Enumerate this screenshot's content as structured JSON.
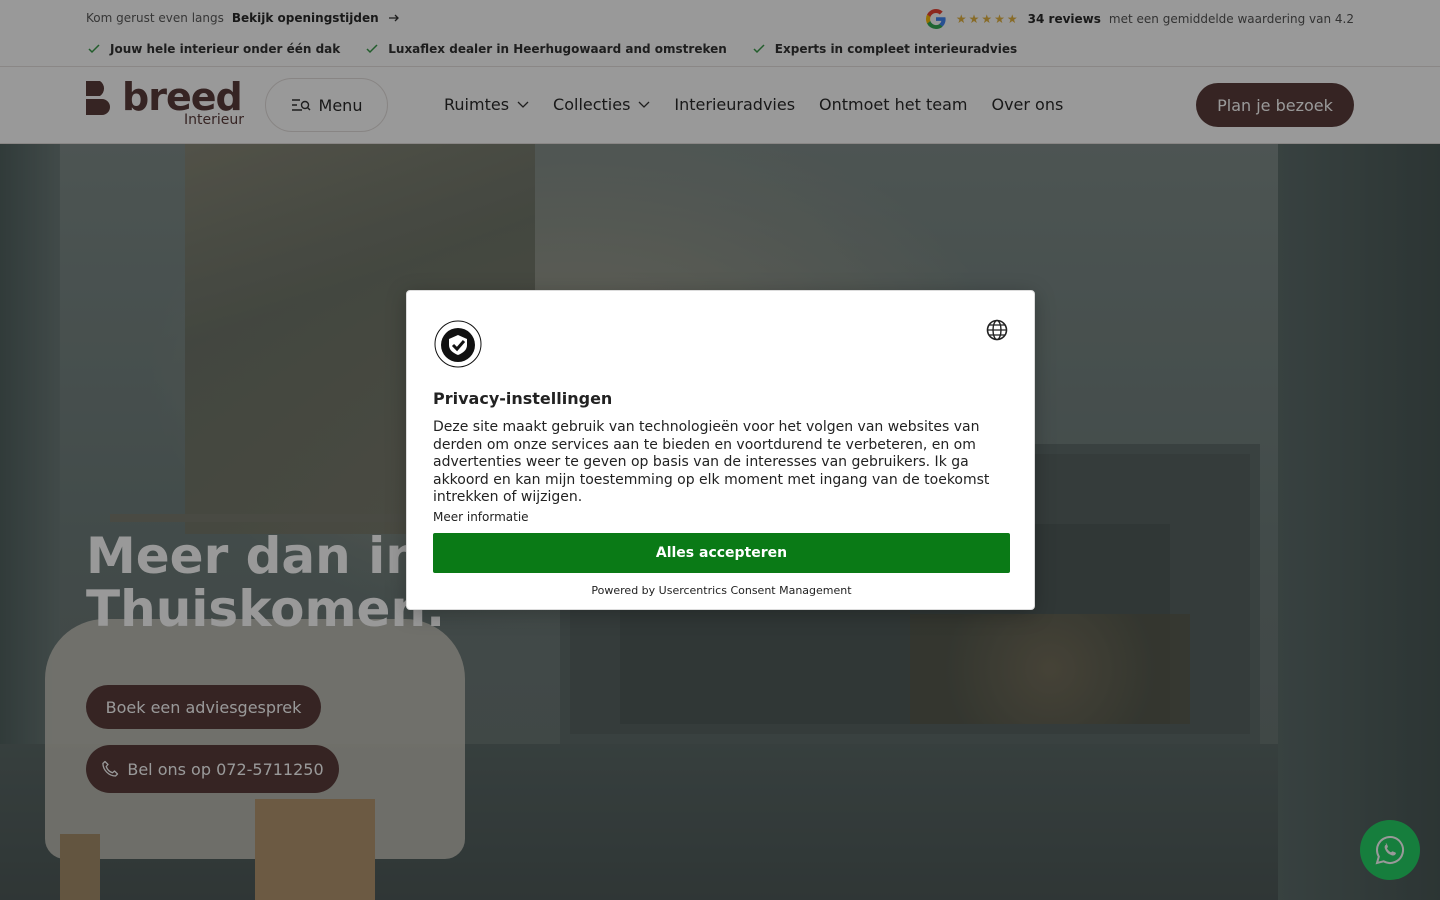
{
  "topbar": {
    "visit_text": "Kom gerust even langs",
    "visit_link": "Bekijk openingstijden",
    "usps": [
      "Jouw hele interieur onder één dak",
      "Luxaflex dealer in Heerhugowaard and omstreken",
      "Experts in compleet interieuradvies"
    ],
    "reviews_count": "34 reviews",
    "reviews_text": "met een gemiddelde waardering van 4.2",
    "stars": "★★★★★"
  },
  "header": {
    "logo_word": "breed",
    "logo_sub": "Interieur",
    "menu_label": "Menu",
    "nav": [
      "Ruimtes",
      "Collecties",
      "Interieuradvies",
      "Ontmoet het team",
      "Over ons"
    ],
    "cta_label": "Plan je bezoek"
  },
  "hero": {
    "title_line1": "Meer dan interieur.",
    "title_line2": "Thuiskomen.",
    "btn_boek": "Boek een adviesgesprek",
    "btn_bel": "Bel ons op 072-5711250"
  },
  "consent": {
    "title": "Privacy-instellingen",
    "body": "Deze site maakt gebruik van technologieën voor het volgen van websites van derden om onze services aan te bieden en voortdurend te verbeteren, en om advertenties weer te geven op basis van de interesses van gebruikers. Ik ga akkoord en kan mijn toestemming op elk moment met ingang van de toekomst intrekken of wijzigen.",
    "more_info": "Meer informatie",
    "accept_label": "Alles accepteren",
    "powered_by": "Powered by Usercentrics Consent Management"
  },
  "colors": {
    "brand": "#5b3d3b",
    "accept_green": "#0a7a16",
    "whatsapp": "#26d367",
    "stars": "#e3b341"
  },
  "icons": [
    "arrow-right-icon",
    "check-icon",
    "google-icon",
    "menu-search-icon",
    "chevron-down-icon",
    "phone-icon",
    "whatsapp-icon",
    "globe-icon",
    "consent-badge-icon"
  ]
}
